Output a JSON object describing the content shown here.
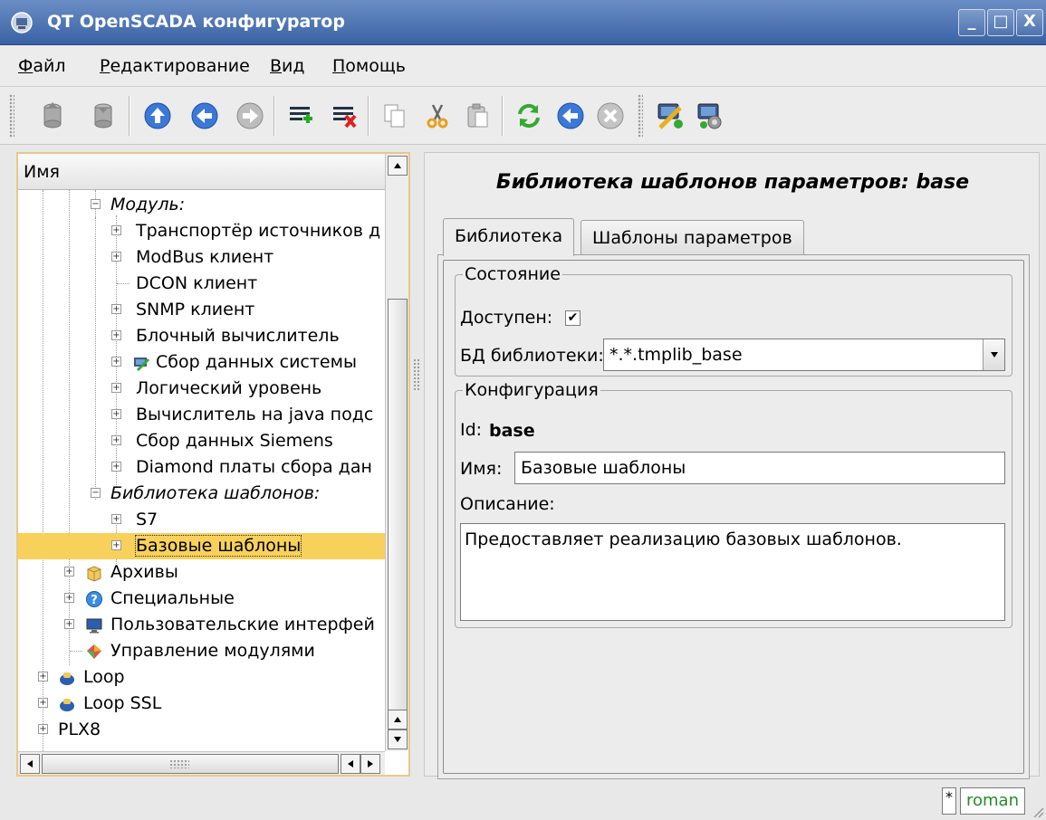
{
  "window": {
    "title": "QT OpenSCADA конфигуратор",
    "controls": [
      "_",
      "□",
      "X"
    ]
  },
  "menu": {
    "items": [
      {
        "underline": "Ф",
        "rest": "айл"
      },
      {
        "underline": "Р",
        "rest": "едактирование"
      },
      {
        "underline": "В",
        "rest": "ид"
      },
      {
        "underline": "П",
        "rest": "омощь"
      }
    ]
  },
  "toolbar": {
    "buttons": [
      "db-load-icon",
      "db-save-icon",
      "up-icon",
      "back-icon",
      "forward-icon",
      "add-item-icon",
      "delete-item-icon",
      "copy-icon",
      "cut-icon",
      "paste-icon",
      "refresh-icon",
      "start-icon",
      "stop-icon",
      "station-config-icon",
      "station-tools-icon"
    ]
  },
  "tree": {
    "header": "Имя",
    "rows": [
      {
        "label": "Модуль:",
        "italic": true
      },
      {
        "label": "Транспортёр источников д"
      },
      {
        "label": "ModBus клиент"
      },
      {
        "label": "DCON клиент"
      },
      {
        "label": "SNMP клиент"
      },
      {
        "label": "Блочный вычислитель"
      },
      {
        "label": "Сбор данных системы"
      },
      {
        "label": "Логический уровень"
      },
      {
        "label": "Вычислитель на java подс"
      },
      {
        "label": "Сбор данных Siemens"
      },
      {
        "label": "Diamond платы сбора дан"
      },
      {
        "label": "Библиотека шаблонов:",
        "italic": true
      },
      {
        "label": "S7"
      },
      {
        "label": "Базовые шаблоны",
        "selected": true
      },
      {
        "label": "Архивы"
      },
      {
        "label": "Специальные"
      },
      {
        "label": "Пользовательские интерфей"
      },
      {
        "label": "Управление модулями"
      },
      {
        "label": "Loop"
      },
      {
        "label": "Loop SSL"
      },
      {
        "label": "PLX8"
      }
    ]
  },
  "page": {
    "title": "Библиотека шаблонов параметров: base",
    "tabs": [
      "Библиотека",
      "Шаблоны параметров"
    ],
    "state": {
      "legend": "Состояние",
      "enabled_label": "Доступен:",
      "enabled": true,
      "db_label": "БД библиотеки:",
      "db_value": "*.*.tmplib_base"
    },
    "config": {
      "legend": "Конфигурация",
      "id_label": "Id:",
      "id_value": "base",
      "name_label": "Имя:",
      "name_value": "Базовые шаблоны",
      "desc_label": "Описание:",
      "desc_value": "Предоставляет реализацию базовых шаблонов."
    }
  },
  "status": {
    "modified": "*",
    "user": "roman"
  }
}
